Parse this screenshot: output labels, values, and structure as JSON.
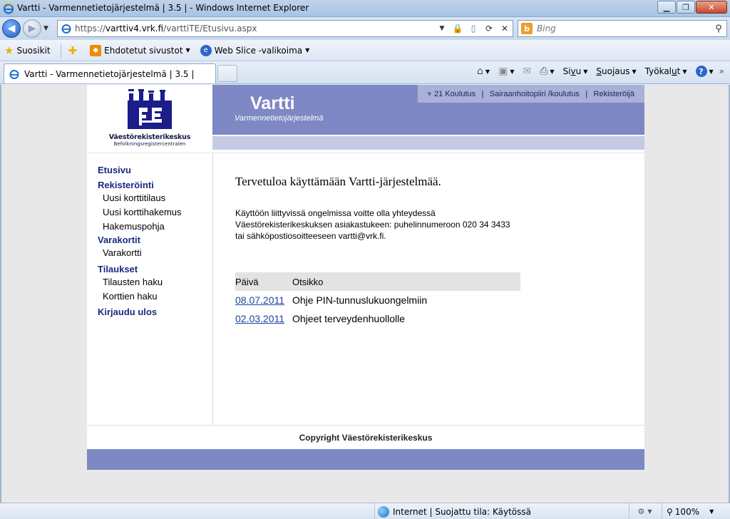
{
  "browser": {
    "window_title": "Vartti - Varmennetietojärjestelmä | 3.5 | - Windows Internet Explorer",
    "url": {
      "scheme": "https://",
      "host": "varttiv4.vrk.fi",
      "path": "/varttiTE/Etusivu.aspx"
    },
    "search_placeholder": "Bing",
    "favorites_bar": {
      "favorites": "Suosikit",
      "suggested": "Ehdotetut sivustot",
      "webslice": "Web Slice -valikoima"
    },
    "tab_label": "Vartti - Varmennetietojärjestelmä | 3.5 |",
    "commands": {
      "page_pre": "Si",
      "page_u": "v",
      "page_post": "u",
      "safety_pre": "",
      "safety_u": "S",
      "safety_post": "uojaus",
      "tools_pre": "Työkal",
      "tools_u": "u",
      "tools_post": "t"
    },
    "status": {
      "zone": "Internet | Suojattu tila: Käytössä",
      "zoom": "100%"
    }
  },
  "site": {
    "org_name": "Väestörekisterikeskus",
    "org_name_sv": "Befolkningsregistercentralen",
    "app_title": "Vartti",
    "app_subtitle": "Varmennetietojärjestelmä",
    "top_links": [
      "21 Koulutus",
      "Sairaanhoitopiiri /koulutus",
      "Rekisteröijä"
    ],
    "nav": {
      "home": "Etusivu",
      "registration": "Rekisteröinti",
      "new_card_order": "Uusi korttitilaus",
      "new_card_application": "Uusi korttihakemus",
      "application_template": "Hakemuspohja",
      "backup_cards": "Varakortit",
      "backup_card": "Varakortti",
      "orders": "Tilaukset",
      "order_search": "Tilausten haku",
      "card_search": "Korttien haku",
      "logout": "Kirjaudu ulos"
    },
    "welcome": "Tervetuloa käyttämään Vartti-järjestelmää.",
    "info_text": "Käyttöön liittyvissä ongelmissa voitte olla yhteydessä Väestörekisterikeskuksen asiakastukeen: puhelinnumeroon 020 34 3433 tai sähköpostiosoitteeseen vartti@vrk.fi.",
    "news": {
      "headers": [
        "Päivä",
        "Otsikko"
      ],
      "rows": [
        {
          "date": "08.07.2011",
          "title": "Ohje PIN-tunnuslukuongelmiin"
        },
        {
          "date": "02.03.2011",
          "title": "Ohjeet terveydenhuollolle"
        }
      ]
    },
    "footer": "Copyright Väestörekisterikeskus"
  },
  "colors": {
    "brand_purple": "#7d88c4",
    "brand_light": "#c6cbe5",
    "nav_blue": "#1a2a80",
    "link_blue": "#1a44a0"
  }
}
